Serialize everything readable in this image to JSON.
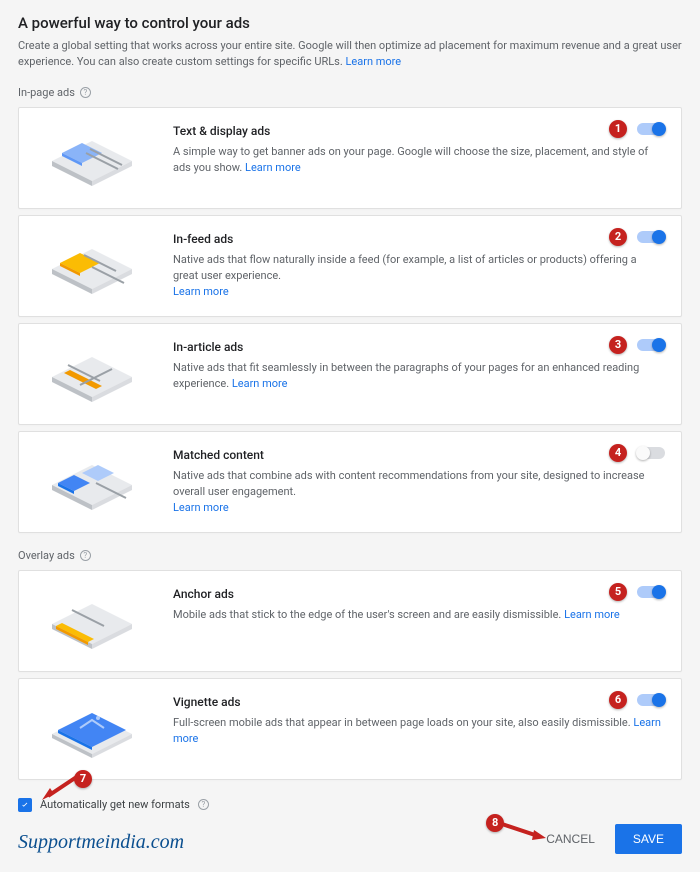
{
  "header": {
    "title": "A powerful way to control your ads",
    "subtitle": "Create a global setting that works across your entire site. Google will then optimize ad placement for maximum revenue and a great user experience. You can also create custom settings for specific URLs.",
    "learn_more": "Learn more"
  },
  "sections": {
    "in_page_label": "In-page ads",
    "overlay_label": "Overlay ads"
  },
  "cards": {
    "text_display": {
      "title": "Text & display ads",
      "desc": "A simple way to get banner ads on your page. Google will choose the size, placement, and style of ads you show.",
      "learn_more": "Learn more",
      "badge": "1",
      "on": true,
      "accent": "#8ab4f8"
    },
    "in_feed": {
      "title": "In-feed ads",
      "desc": "Native ads that flow naturally inside a feed (for example, a list of articles or products) offering a great user experience.",
      "learn_more": "Learn more",
      "badge": "2",
      "on": true,
      "accent": "#fbbc04"
    },
    "in_article": {
      "title": "In-article ads",
      "desc": "Native ads that fit seamlessly in between the paragraphs of your pages for an enhanced reading experience.",
      "learn_more": "Learn more",
      "badge": "3",
      "on": true,
      "accent": "#f29900"
    },
    "matched": {
      "title": "Matched content",
      "desc": "Native ads that combine ads with content recommendations from your site, designed to increase overall user engagement.",
      "learn_more": "Learn more",
      "badge": "4",
      "on": false,
      "accent": "#4285f4"
    },
    "anchor": {
      "title": "Anchor ads",
      "desc": "Mobile ads that stick to the edge of the user's screen and are easily dismissible.",
      "learn_more": "Learn more",
      "badge": "5",
      "on": true,
      "accent": "#fbbc04"
    },
    "vignette": {
      "title": "Vignette ads",
      "desc": "Full-screen mobile ads that appear in between page loads on your site, also easily dismissible.",
      "learn_more": "Learn more",
      "badge": "6",
      "on": true,
      "accent": "#4285f4"
    }
  },
  "auto_checkbox": {
    "label": "Automatically get new formats",
    "badge": "7"
  },
  "footer": {
    "brand": "Supportmeindia.com",
    "cancel": "CANCEL",
    "save": "SAVE",
    "badge": "8"
  }
}
